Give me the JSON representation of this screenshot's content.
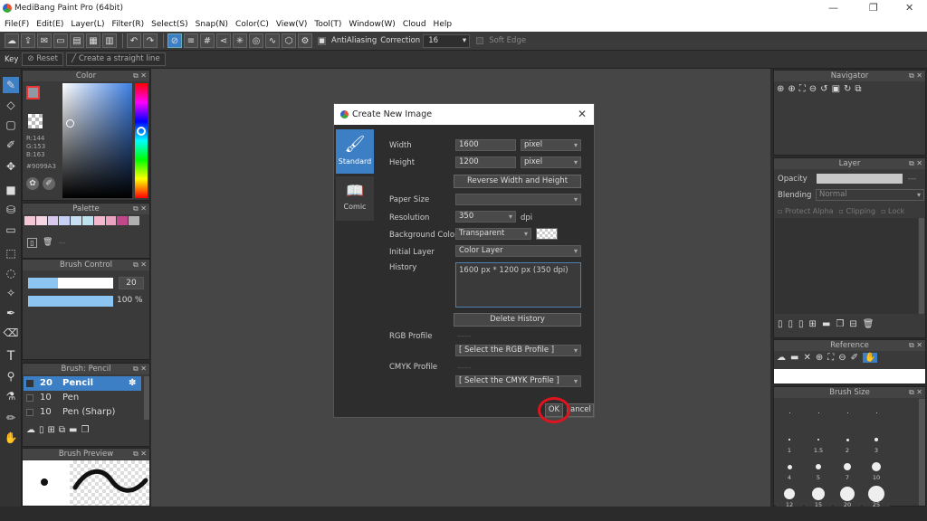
{
  "app": {
    "title": "MediBang Paint Pro (64bit)"
  },
  "menu": [
    "File(F)",
    "Edit(E)",
    "Layer(L)",
    "Filter(R)",
    "Select(S)",
    "Snap(N)",
    "Color(C)",
    "View(V)",
    "Tool(T)",
    "Window(W)",
    "Cloud",
    "Help"
  ],
  "toolbar": {
    "antialiasing": "AntiAliasing",
    "correction_label": "Correction",
    "correction_value": "16",
    "soft_edge": "Soft Edge"
  },
  "subbar": {
    "key": "Key",
    "reset": "Reset",
    "straight": "Create a straight line"
  },
  "color_panel": {
    "title": "Color",
    "r": "R:144",
    "g": "G:153",
    "b": "B:163",
    "hex": "#9099A3"
  },
  "palette_panel": {
    "title": "Palette",
    "dash": "---",
    "swatches": [
      "#f4c6d6",
      "#f6d5e4",
      "#d8c8f0",
      "#c6d0f5",
      "#c9e0f4",
      "#bde3ee",
      "#f3b8cf",
      "#e9a3c0",
      "#c0478a",
      "#b0b0b0"
    ]
  },
  "brush_control": {
    "title": "Brush Control",
    "size": "20",
    "opacity": "100 %",
    "size_fill": 0.35,
    "opacity_fill": 1.0
  },
  "brush_list": {
    "title": "Brush: Pencil",
    "items": [
      {
        "size": "20",
        "name": "Pencil"
      },
      {
        "size": "10",
        "name": "Pen"
      },
      {
        "size": "10",
        "name": "Pen (Sharp)"
      }
    ]
  },
  "brush_preview": {
    "title": "Brush Preview"
  },
  "navigator": {
    "title": "Navigator"
  },
  "layer_panel": {
    "title": "Layer",
    "opacity_label": "Opacity",
    "opacity_value": "---",
    "blending_label": "Blending",
    "blending_value": "Normal",
    "protect_alpha": "Protect Alpha",
    "clipping": "Clipping",
    "lock": "Lock"
  },
  "reference_panel": {
    "title": "Reference"
  },
  "brush_size_panel": {
    "title": "Brush Size",
    "sizes": [
      "",
      "",
      "",
      "",
      "1",
      "1.5",
      "2",
      "3",
      "4",
      "5",
      "7",
      "10",
      "12",
      "15",
      "20",
      "25"
    ]
  },
  "dialog": {
    "title": "Create New Image",
    "tabs": [
      {
        "label": "Standard"
      },
      {
        "label": "Comic"
      }
    ],
    "width_label": "Width",
    "width_value": "1600",
    "width_unit": "pixel",
    "height_label": "Height",
    "height_value": "1200",
    "height_unit": "pixel",
    "reverse_button": "Reverse Width and Height",
    "paper_size_label": "Paper Size",
    "paper_size_value": "",
    "resolution_label": "Resolution",
    "resolution_value": "350",
    "resolution_unit": "dpi",
    "bg_color_label": "Background Color",
    "bg_color_value": "Transparent",
    "initial_layer_label": "Initial Layer",
    "initial_layer_value": "Color Layer",
    "history_label": "History",
    "history_item": "1600 px * 1200 px (350 dpi)",
    "delete_history_button": "Delete History",
    "rgb_label": "RGB Profile",
    "rgb_dash": "------",
    "rgb_value": "[ Select the RGB Profile ]",
    "cmyk_label": "CMYK Profile",
    "cmyk_dash": "------",
    "cmyk_value": "[ Select the CMYK Profile ]",
    "ok_button": "OK",
    "cancel_button": "ancel"
  },
  "colors": {
    "accent": "#3d7fc4",
    "highlight_ring": "#e0141e"
  }
}
